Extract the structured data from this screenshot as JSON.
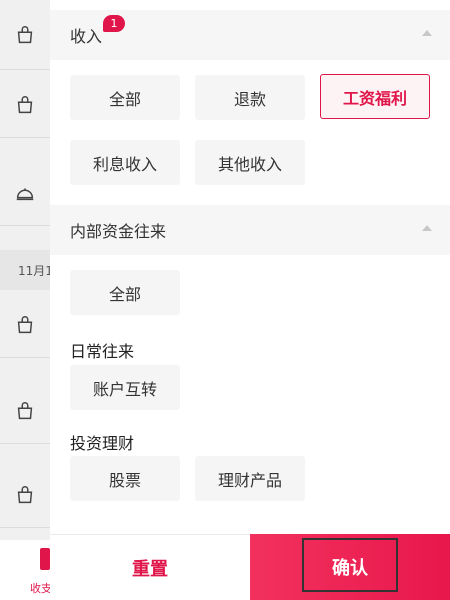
{
  "background": {
    "date_label": "11月1",
    "tab_label": "收支"
  },
  "sections": {
    "income": {
      "title": "收入",
      "badge": "1",
      "chips": [
        "全部",
        "退款",
        "工资福利",
        "利息收入",
        "其他收入"
      ],
      "selected": "工资福利"
    },
    "internal": {
      "title": "内部资金往来",
      "all_label": "全部",
      "daily": {
        "title": "日常往来",
        "chips": [
          "账户互转"
        ]
      },
      "investment": {
        "title": "投资理财",
        "chips": [
          "股票",
          "理财产品"
        ]
      }
    }
  },
  "actions": {
    "reset_label": "重置",
    "confirm_label": "确认"
  },
  "colors": {
    "accent": "#e0164a",
    "chip_bg": "#f5f5f5",
    "header_bg": "#f6f6f6"
  }
}
